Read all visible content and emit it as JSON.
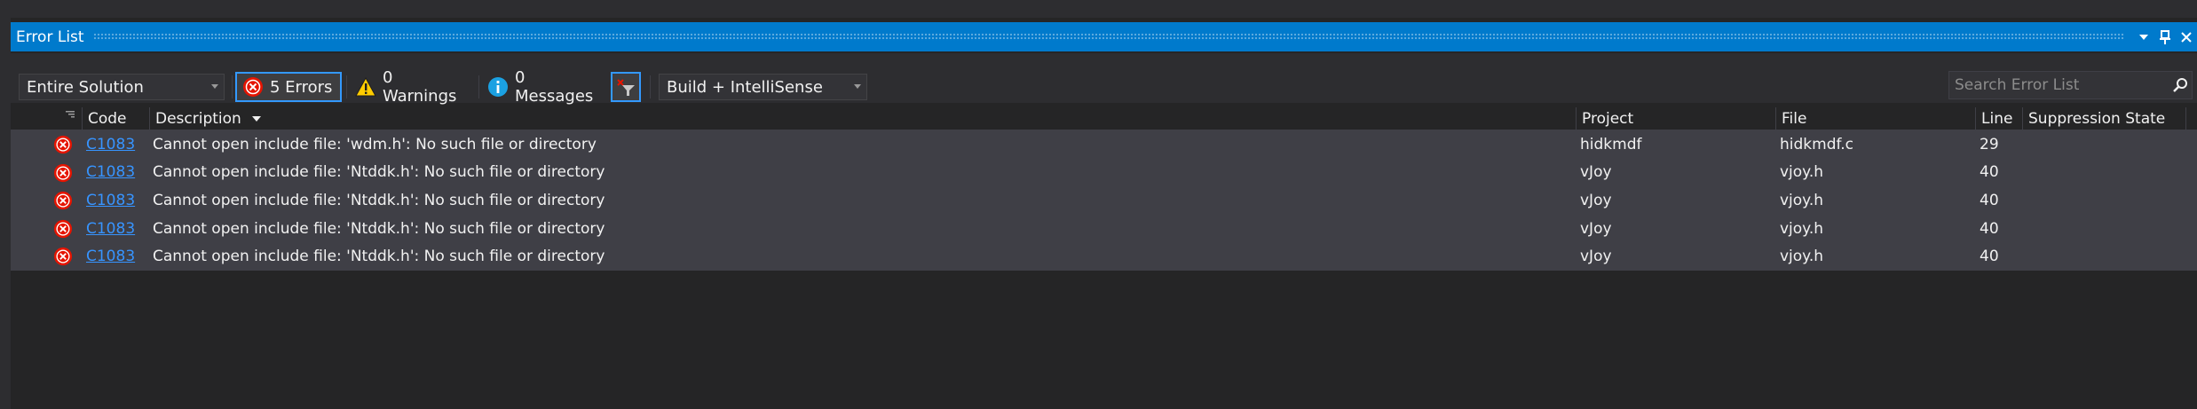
{
  "window": {
    "title": "Error List",
    "dropdown_icon": "chevron-down-icon",
    "pin_icon": "pin-icon",
    "close_icon": "close-icon"
  },
  "toolbar": {
    "scope_value": "Entire Solution",
    "errors_label": "5 Errors",
    "warnings_label": "0 Warnings",
    "messages_label": "0 Messages",
    "build_filter_value": "Build + IntelliSense",
    "search_placeholder": "Search Error List"
  },
  "columns": {
    "code": "Code",
    "description": "Description",
    "project": "Project",
    "file": "File",
    "line": "Line",
    "suppression": "Suppression State"
  },
  "rows": [
    {
      "code": "C1083",
      "description": "Cannot open include file: 'wdm.h': No such file or directory",
      "project": "hidkmdf",
      "file": "hidkmdf.c",
      "line": "29",
      "suppression": ""
    },
    {
      "code": "C1083",
      "description": "Cannot open include file: 'Ntddk.h': No such file or directory",
      "project": "vJoy",
      "file": "vjoy.h",
      "line": "40",
      "suppression": ""
    },
    {
      "code": "C1083",
      "description": "Cannot open include file: 'Ntddk.h': No such file or directory",
      "project": "vJoy",
      "file": "vjoy.h",
      "line": "40",
      "suppression": ""
    },
    {
      "code": "C1083",
      "description": "Cannot open include file: 'Ntddk.h': No such file or directory",
      "project": "vJoy",
      "file": "vjoy.h",
      "line": "40",
      "suppression": ""
    },
    {
      "code": "C1083",
      "description": "Cannot open include file: 'Ntddk.h': No such file or directory",
      "project": "vJoy",
      "file": "vjoy.h",
      "line": "40",
      "suppression": ""
    }
  ],
  "colors": {
    "accent": "#007acc",
    "panel_bg": "#252526",
    "row_bg": "#3f3f46",
    "error": "#e51400",
    "warning": "#ffcc00",
    "info": "#1ba1e2",
    "link": "#3794ff"
  }
}
